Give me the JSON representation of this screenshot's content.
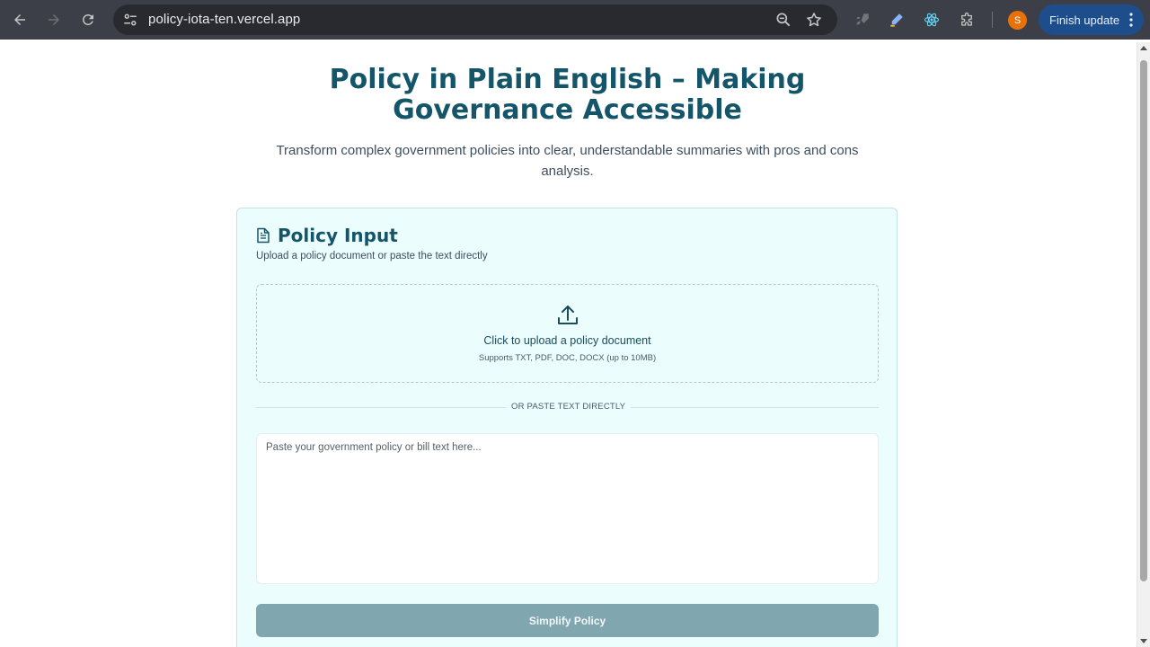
{
  "browser": {
    "url": "policy-iota-ten.vercel.app",
    "profile_initial": "S",
    "finish_update_label": "Finish update",
    "icons": {
      "back": "back-arrow-icon",
      "forward": "forward-arrow-icon",
      "reload": "reload-icon",
      "site_settings": "tune-icon",
      "zoom": "zoom-icon",
      "bookmark": "star-icon",
      "extensions": [
        "rocket-icon",
        "pen-icon",
        "react-icon",
        "puzzle-icon"
      ],
      "menu": "kebab-menu-icon"
    },
    "colors": {
      "toolbar": "#3c3f47",
      "omnibox": "#282a2f",
      "finish_update": "#1e4d8c",
      "avatar": "#e8710a"
    }
  },
  "page": {
    "title_line1": "Policy in Plain English – Making",
    "title_line2": "Governance Accessible",
    "subtitle": "Transform complex government policies into clear, understandable summaries with pros and cons analysis.",
    "card": {
      "title": "Policy Input",
      "description": "Upload a policy document or paste the text directly",
      "upload_title": "Click to upload a policy document",
      "upload_note": "Supports TXT, PDF, DOC, DOCX (up to 10MB)",
      "separator_label": "OR PASTE TEXT DIRECTLY",
      "textarea_placeholder": "Paste your government policy or bill text here...",
      "textarea_value": "",
      "submit_label": "Simplify Policy"
    },
    "colors": {
      "heading": "#145569",
      "card_bg": "#ecfdfe",
      "button_bg": "#80a6b0"
    }
  }
}
